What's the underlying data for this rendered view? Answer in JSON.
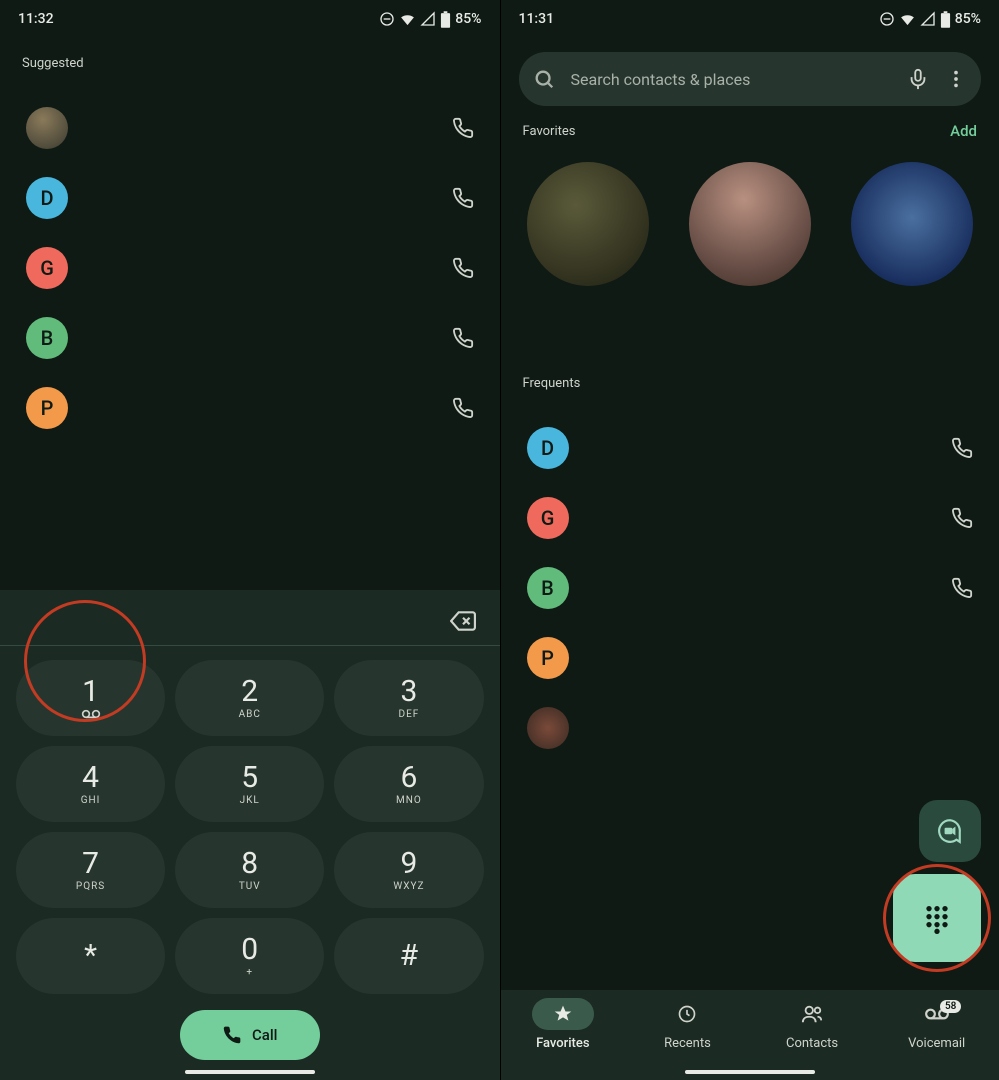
{
  "left": {
    "status": {
      "time": "11:32",
      "battery": "85%"
    },
    "suggested_label": "Suggested",
    "contacts": [
      {
        "type": "photo"
      },
      {
        "letter": "D",
        "color": "#49b7dd"
      },
      {
        "letter": "G",
        "color": "#ef6a5d"
      },
      {
        "letter": "B",
        "color": "#61bb7a"
      },
      {
        "letter": "P",
        "color": "#f2994a"
      }
    ],
    "dial_keys": [
      {
        "num": "1",
        "sub": "",
        "vm": true
      },
      {
        "num": "2",
        "sub": "ABC"
      },
      {
        "num": "3",
        "sub": "DEF"
      },
      {
        "num": "4",
        "sub": "GHI"
      },
      {
        "num": "5",
        "sub": "JKL"
      },
      {
        "num": "6",
        "sub": "MNO"
      },
      {
        "num": "7",
        "sub": "PQRS"
      },
      {
        "num": "8",
        "sub": "TUV"
      },
      {
        "num": "9",
        "sub": "WXYZ"
      },
      {
        "num": "*",
        "sub": ""
      },
      {
        "num": "0",
        "sub": "+"
      },
      {
        "num": "#",
        "sub": ""
      }
    ],
    "call_label": "Call"
  },
  "right": {
    "status": {
      "time": "11:31",
      "battery": "85%"
    },
    "search_placeholder": "Search contacts & places",
    "favorites_label": "Favorites",
    "add_label": "Add",
    "frequents_label": "Frequents",
    "freq_contacts": [
      {
        "letter": "D",
        "color": "#49b7dd",
        "call": true
      },
      {
        "letter": "G",
        "color": "#ef6a5d",
        "call": true
      },
      {
        "letter": "B",
        "color": "#61bb7a",
        "call": true
      },
      {
        "letter": "P",
        "color": "#f2994a",
        "call": false
      },
      {
        "type": "photo",
        "call": false
      }
    ],
    "nav": {
      "favorites": "Favorites",
      "recents": "Recents",
      "contacts": "Contacts",
      "voicemail": "Voicemail",
      "vm_count": "58"
    }
  }
}
